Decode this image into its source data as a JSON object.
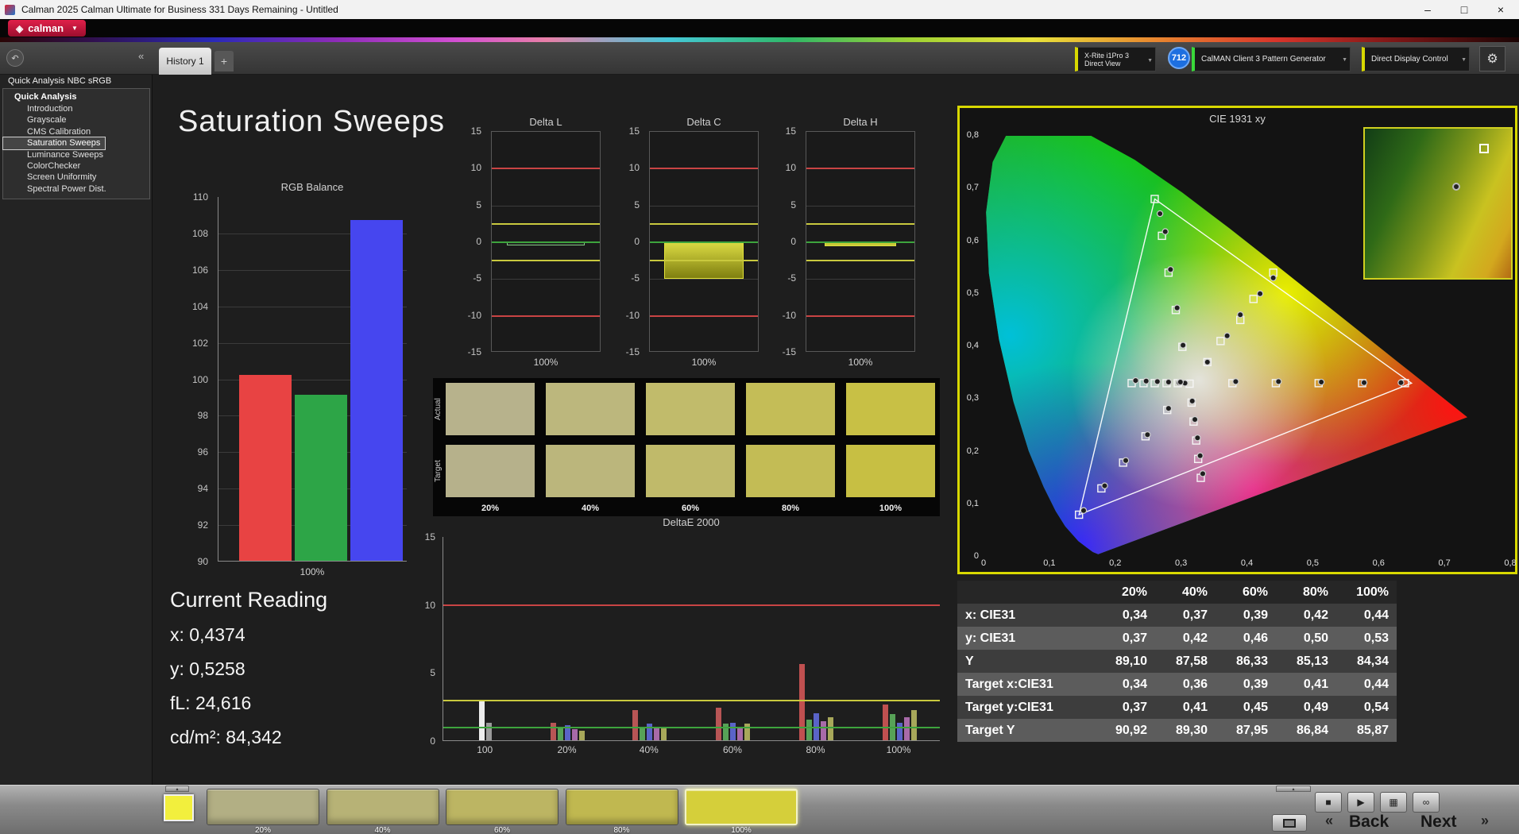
{
  "icons": {
    "logo_diamond": "◈",
    "dropdown": "▼",
    "minimize": "–",
    "maximize": "□",
    "close": "×",
    "undo": "↶",
    "collapse": "«",
    "tab_plus": "+",
    "gear": "⚙",
    "eject": "▴",
    "stop": "■",
    "play": "▶",
    "pattern_window": "▦",
    "loop": "∞",
    "back_chevrons": "«",
    "next_chevrons": "»"
  },
  "titlebar": {
    "title": "Calman 2025 Calman Ultimate for Business 331 Days Remaining  - Untitled"
  },
  "brand": {
    "logo_text": "calman"
  },
  "toolbar": {
    "history_tab": "History 1",
    "meter_line1": "X-Rite i1Pro 3",
    "meter_line2": "Direct View",
    "badge": "712",
    "source_dropdown": "CalMAN Client 3 Pattern Generator",
    "display_dropdown": "Direct Display Control"
  },
  "sidebar": {
    "title": "Quick Analysis NBC sRGB",
    "root": "Quick Analysis",
    "selected": "Saturation Sweeps",
    "items": [
      "Introduction",
      "Grayscale",
      "CMS Calibration",
      "Saturation Sweeps",
      "Luminance Sweeps",
      "ColorChecker",
      "Screen Uniformity",
      "Spectral Power Dist."
    ]
  },
  "page": {
    "title": "Saturation Sweeps"
  },
  "current_reading": {
    "title": "Current Reading",
    "x": "x: 0,4374",
    "y": "y: 0,5258",
    "fl": "fL: 24,616",
    "cdm2": "cd/m²: 84,342"
  },
  "saturation_swatches": {
    "row_labels": [
      "Actual",
      "Target"
    ],
    "labels": [
      "20%",
      "40%",
      "60%",
      "80%",
      "100%"
    ],
    "actual": [
      "#b7b28c",
      "#bcb77d",
      "#c1bb6b",
      "#c4bd57",
      "#c8c045"
    ],
    "target": [
      "#b6b18b",
      "#bbb67c",
      "#c0ba6a",
      "#c3bc55",
      "#c7bf43"
    ]
  },
  "chart_data": {
    "rgb_balance": {
      "type": "bar",
      "title": "RGB Balance",
      "xlabel": "100%",
      "ylim": [
        90,
        110
      ],
      "ytick_step": 2,
      "bars": [
        {
          "label": "Red",
          "value": 100.2,
          "color": "#e84343"
        },
        {
          "label": "Green",
          "value": 99.1,
          "color": "#2da547"
        },
        {
          "label": "Blue",
          "value": 108.7,
          "color": "#4646ef"
        }
      ]
    },
    "delta": [
      {
        "type": "bar",
        "title": "Delta L",
        "xlabel": "100%",
        "ylim": [
          -15,
          15
        ],
        "value": -0.4,
        "limits": {
          "red": 10,
          "yellow": 2.5,
          "green": 0
        },
        "bar_width_pct": 72,
        "bar_fill": "#202020",
        "bar_stroke": "#86c986"
      },
      {
        "type": "bar",
        "title": "Delta C",
        "xlabel": "100%",
        "ylim": [
          -15,
          15
        ],
        "value": -5.0,
        "limits": {
          "red": 10,
          "yellow": 2.5,
          "green": 0
        },
        "bar_width_pct": 74,
        "bar_fill": "linear-gradient(#d9d942,#7f7f10)",
        "bar_stroke": "#e4e43a"
      },
      {
        "type": "bar",
        "title": "Delta H",
        "xlabel": "100%",
        "ylim": [
          -15,
          15
        ],
        "value": -0.5,
        "limits": {
          "red": 10,
          "yellow": 2.5,
          "green": 0
        },
        "bar_width_pct": 66,
        "bar_fill": "#c9c936",
        "bar_stroke": "#dcdc40"
      }
    ],
    "deltae": {
      "type": "bar",
      "title": "DeltaE 2000",
      "ylim": [
        0,
        15
      ],
      "yticks": [
        0,
        5,
        10,
        15
      ],
      "limit_lines": {
        "red": 10,
        "yellow": 3,
        "green": 1
      },
      "groups": [
        {
          "label": "100",
          "frac": 0.085,
          "bars": [
            {
              "c": "#ececec",
              "v": 3.0
            },
            {
              "c": "#9a9a9a",
              "v": 1.3
            }
          ]
        },
        {
          "label": "20%",
          "frac": 0.25,
          "bars": [
            {
              "c": "#b85555",
              "v": 1.3
            },
            {
              "c": "#57a257",
              "v": 0.9
            },
            {
              "c": "#5a64c8",
              "v": 1.1
            },
            {
              "c": "#a86aa8",
              "v": 0.8
            },
            {
              "c": "#a8a85a",
              "v": 0.7
            }
          ]
        },
        {
          "label": "40%",
          "frac": 0.415,
          "bars": [
            {
              "c": "#b85555",
              "v": 2.2
            },
            {
              "c": "#57a257",
              "v": 1.0
            },
            {
              "c": "#5a64c8",
              "v": 1.2
            },
            {
              "c": "#a86aa8",
              "v": 0.9
            },
            {
              "c": "#a8a85a",
              "v": 0.9
            }
          ]
        },
        {
          "label": "60%",
          "frac": 0.583,
          "bars": [
            {
              "c": "#b85555",
              "v": 2.4
            },
            {
              "c": "#57a257",
              "v": 1.2
            },
            {
              "c": "#5a64c8",
              "v": 1.3
            },
            {
              "c": "#a86aa8",
              "v": 1.0
            },
            {
              "c": "#a8a85a",
              "v": 1.2
            }
          ]
        },
        {
          "label": "80%",
          "frac": 0.75,
          "bars": [
            {
              "c": "#c05050",
              "v": 5.6
            },
            {
              "c": "#57a257",
              "v": 1.5
            },
            {
              "c": "#5a64c8",
              "v": 2.0
            },
            {
              "c": "#a86aa8",
              "v": 1.4
            },
            {
              "c": "#a8a85a",
              "v": 1.7
            }
          ]
        },
        {
          "label": "100%",
          "frac": 0.917,
          "bars": [
            {
              "c": "#c05050",
              "v": 2.6
            },
            {
              "c": "#57a257",
              "v": 1.9
            },
            {
              "c": "#5a64c8",
              "v": 1.3
            },
            {
              "c": "#a86aa8",
              "v": 1.7
            },
            {
              "c": "#a8a85a",
              "v": 2.2
            }
          ]
        }
      ]
    },
    "cie": {
      "type": "scatter",
      "title": "CIE 1931 xy",
      "range": [
        0,
        0.8
      ],
      "x_ticks": [
        "0",
        "0,1",
        "0,2",
        "0,3",
        "0,4",
        "0,5",
        "0,6",
        "0,7",
        "0,8"
      ],
      "y_ticks": [
        "0,8",
        "0,7",
        "0,6",
        "0,5",
        "0,4",
        "0,3",
        "0,2",
        "0,1",
        "0"
      ],
      "triangle": [
        [
          0.65,
          0.33
        ],
        [
          0.26,
          0.68
        ],
        [
          0.145,
          0.08
        ]
      ],
      "white_point": [
        0.313,
        0.329
      ],
      "targets": [
        [
          0.378,
          0.33
        ],
        [
          0.444,
          0.33
        ],
        [
          0.509,
          0.33
        ],
        [
          0.575,
          0.33
        ],
        [
          0.64,
          0.33
        ],
        [
          0.302,
          0.399
        ],
        [
          0.292,
          0.469
        ],
        [
          0.281,
          0.54
        ],
        [
          0.271,
          0.61
        ],
        [
          0.26,
          0.68
        ],
        [
          0.279,
          0.279
        ],
        [
          0.246,
          0.229
        ],
        [
          0.212,
          0.179
        ],
        [
          0.179,
          0.13
        ],
        [
          0.145,
          0.08
        ],
        [
          0.34,
          0.37
        ],
        [
          0.36,
          0.41
        ],
        [
          0.39,
          0.45
        ],
        [
          0.41,
          0.49
        ],
        [
          0.44,
          0.54
        ],
        [
          0.295,
          0.33
        ],
        [
          0.278,
          0.33
        ],
        [
          0.26,
          0.33
        ],
        [
          0.243,
          0.33
        ],
        [
          0.225,
          0.33
        ],
        [
          0.316,
          0.293
        ],
        [
          0.319,
          0.257
        ],
        [
          0.323,
          0.221
        ],
        [
          0.326,
          0.186
        ],
        [
          0.33,
          0.15
        ],
        [
          0.313,
          0.329
        ]
      ],
      "measurements": [
        [
          0.383,
          0.333
        ],
        [
          0.448,
          0.333
        ],
        [
          0.513,
          0.332
        ],
        [
          0.578,
          0.331
        ],
        [
          0.634,
          0.331
        ],
        [
          0.303,
          0.402
        ],
        [
          0.294,
          0.473
        ],
        [
          0.284,
          0.546
        ],
        [
          0.276,
          0.618
        ],
        [
          0.268,
          0.652
        ],
        [
          0.281,
          0.282
        ],
        [
          0.249,
          0.232
        ],
        [
          0.216,
          0.183
        ],
        [
          0.184,
          0.135
        ],
        [
          0.152,
          0.088
        ],
        [
          0.34,
          0.37
        ],
        [
          0.37,
          0.42
        ],
        [
          0.39,
          0.46
        ],
        [
          0.42,
          0.5
        ],
        [
          0.44,
          0.53
        ],
        [
          0.297,
          0.331
        ],
        [
          0.281,
          0.332
        ],
        [
          0.264,
          0.333
        ],
        [
          0.247,
          0.334
        ],
        [
          0.231,
          0.335
        ],
        [
          0.317,
          0.296
        ],
        [
          0.321,
          0.261
        ],
        [
          0.325,
          0.226
        ],
        [
          0.329,
          0.192
        ],
        [
          0.333,
          0.158
        ],
        [
          0.306,
          0.33
        ],
        [
          0.299,
          0.332
        ]
      ],
      "inset": {
        "square": [
          0.78,
          0.1
        ],
        "circle": [
          0.6,
          0.36
        ]
      }
    }
  },
  "table": {
    "header": [
      "",
      "20%",
      "40%",
      "60%",
      "80%",
      "100%"
    ],
    "rows": [
      {
        "label": "x: CIE31",
        "values": [
          "0,34",
          "0,37",
          "0,39",
          "0,42",
          "0,44"
        ]
      },
      {
        "label": "y: CIE31",
        "values": [
          "0,37",
          "0,42",
          "0,46",
          "0,50",
          "0,53"
        ]
      },
      {
        "label": "Y",
        "values": [
          "89,10",
          "87,58",
          "86,33",
          "85,13",
          "84,34"
        ]
      },
      {
        "label": "Target x:CIE31",
        "values": [
          "0,34",
          "0,36",
          "0,39",
          "0,41",
          "0,44"
        ]
      },
      {
        "label": "Target y:CIE31",
        "values": [
          "0,37",
          "0,41",
          "0,45",
          "0,49",
          "0,54"
        ]
      },
      {
        "label": "Target Y",
        "values": [
          "90,92",
          "89,30",
          "87,95",
          "86,84",
          "85,87"
        ]
      }
    ]
  },
  "bottom": {
    "pattern_color": "#f2ef3d",
    "selected": "100%",
    "back": "Back",
    "next": "Next",
    "buttons": [
      {
        "label": "20%",
        "color": "#b2af84"
      },
      {
        "label": "40%",
        "color": "#b7b276"
      },
      {
        "label": "60%",
        "color": "#bcb563"
      },
      {
        "label": "80%",
        "color": "#c0b850"
      },
      {
        "label": "100%",
        "color": "#d5cf3a"
      }
    ]
  }
}
